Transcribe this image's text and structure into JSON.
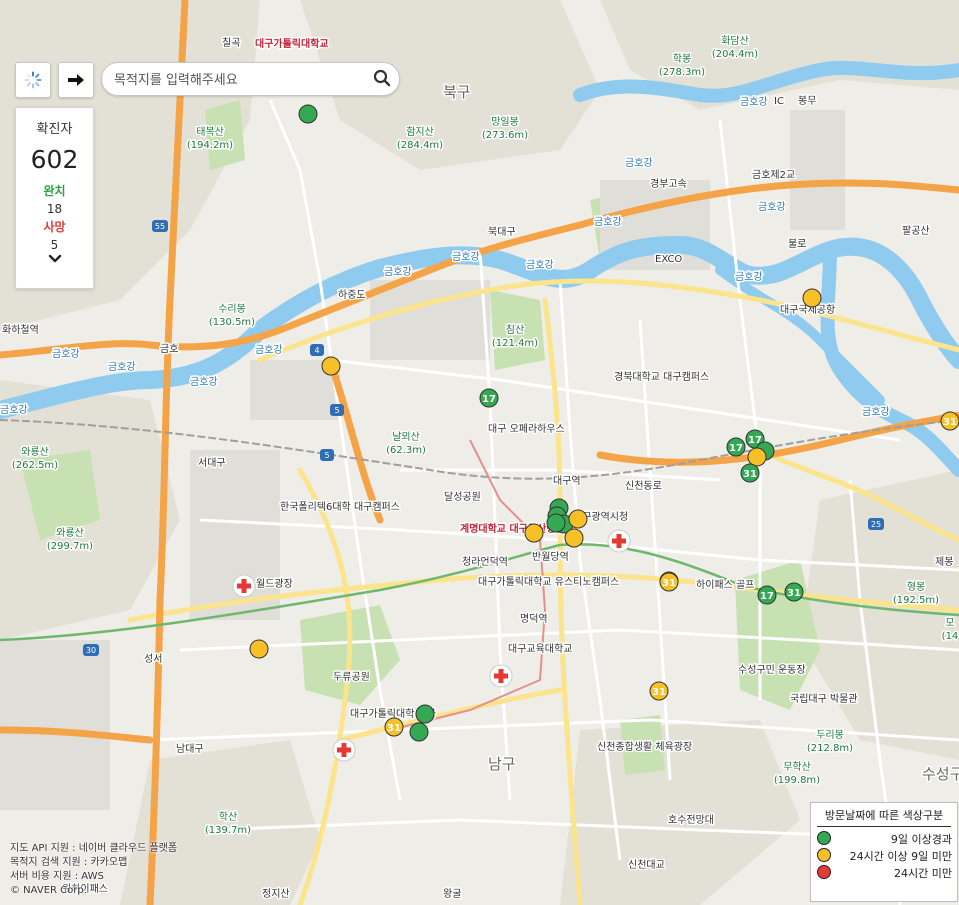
{
  "search": {
    "placeholder": "목적지를 입력해주세요"
  },
  "stats": {
    "confirmed_label": "확진자",
    "confirmed": "602",
    "recovered_label": "완치",
    "recovered": "18",
    "deaths_label": "사망",
    "deaths": "5"
  },
  "attribution": [
    "지도 API 지원 : 네이버 클라우드 플랫폼",
    "목적지 검색 지원 : 카카오맵",
    "서버 비용 지원 : AWS",
    "© NAVER Corp."
  ],
  "legend": {
    "title": "방문날짜에 따른 색상구분",
    "items": [
      {
        "label": "9일 이상경과",
        "color": "#34a853"
      },
      {
        "label": "24시간 이상 9일 미만",
        "color": "#f6c026"
      },
      {
        "label": "24시간 미만",
        "color": "#e53935"
      }
    ]
  },
  "colors": {
    "green": "#34a853",
    "yellow": "#f6c026",
    "red": "#e53935",
    "water": "#7ec3ec",
    "motorway": "#f7b35e",
    "park": "#b9d9a6"
  },
  "map": {
    "districts": [
      "북구",
      "남구",
      "수성구"
    ],
    "rivers": [
      "금호강",
      "금호강",
      "금호강",
      "금호강",
      "금호강",
      "금호강",
      "금호강",
      "금호강",
      "금호강",
      "금호강",
      "금호강",
      "금호강",
      "금호강",
      "금호강"
    ],
    "mountains": [
      {
        "name": "태복산",
        "height": "(194.2m)"
      },
      {
        "name": "함지산",
        "height": "(284.4m)"
      },
      {
        "name": "망일봉",
        "height": "(273.6m)"
      },
      {
        "name": "학봉",
        "height": "(278.3m)"
      },
      {
        "name": "화담산",
        "height": "(204.4m)"
      },
      {
        "name": "수리봉",
        "height": "(130.5m)"
      },
      {
        "name": "침산",
        "height": "(121.4m)"
      },
      {
        "name": "와룡산",
        "height": "(262.5m)"
      },
      {
        "name": "날뫼산",
        "height": "(62.3m)"
      },
      {
        "name": "와룡산",
        "height": "(299.7m)"
      },
      {
        "name": "형봉",
        "height": "(192.5m)"
      },
      {
        "name": "두리봉",
        "height": "(212.8m)"
      },
      {
        "name": "무학산",
        "height": "(199.8m)"
      },
      {
        "name": "학산",
        "height": "(139.7m)"
      },
      {
        "name": "모",
        "height": "(14"
      }
    ],
    "places": [
      "칠곡",
      "대구가톨릭대학교",
      "봉무",
      "IC",
      "금호제2교",
      "경부고속",
      "북대구",
      "EXCO",
      "불로",
      "팔공산",
      "하중도",
      "금호",
      "대구국제공항",
      "화하철역",
      "대구 오페라하우스",
      "경북대학교 대구캠퍼스",
      "서대구",
      "대구역",
      "달성공원",
      "신천동로",
      "대구광역시청",
      "계명대학교 대구동산병원",
      "반월당역",
      "한국폴리텍6대학 대구캠퍼스",
      "청라언덕역",
      "대구가톨릭대학교 유스티노캠퍼스",
      "명덕역",
      "하이패스 골프",
      "제봉",
      "월드광장",
      "성서",
      "두류공원",
      "대구교육대학교",
      "대구가톨릭대학 루가",
      "남대구",
      "수성구민 운동장",
      "국립대구 박물관",
      "신천종합생활 체육광장",
      "호수전망대",
      "신천대교",
      "정지산",
      "왕굴",
      "워하이패스"
    ],
    "route_numbers": [
      "55",
      "4",
      "5",
      "5",
      "30",
      "25"
    ],
    "markers": [
      {
        "color": "green",
        "label": ""
      },
      {
        "color": "yellow",
        "label": ""
      },
      {
        "color": "green",
        "label": "17"
      },
      {
        "color": "yellow",
        "label": ""
      },
      {
        "color": "green",
        "label": "17"
      },
      {
        "color": "green",
        "label": "17"
      },
      {
        "color": "green",
        "label": ""
      },
      {
        "color": "yellow",
        "label": ""
      },
      {
        "color": "green",
        "label": "31"
      },
      {
        "color": "yellow",
        "label": "31"
      },
      {
        "color": "green",
        "label": ""
      },
      {
        "color": "green",
        "label": ""
      },
      {
        "color": "green",
        "label": ""
      },
      {
        "color": "yellow",
        "label": ""
      },
      {
        "color": "yellow",
        "label": ""
      },
      {
        "color": "yellow",
        "label": ""
      },
      {
        "color": "yellow",
        "label": ""
      },
      {
        "color": "yellow",
        "label": "31"
      },
      {
        "color": "green",
        "label": "17"
      },
      {
        "color": "green",
        "label": "31"
      },
      {
        "color": "yellow",
        "label": "31"
      },
      {
        "color": "yellow",
        "label": ""
      },
      {
        "color": "green",
        "label": ""
      },
      {
        "color": "green",
        "label": ""
      },
      {
        "color": "yellow",
        "label": "31"
      },
      {
        "color": "green",
        "label": ""
      }
    ],
    "hospital_icon": "red-cross-icon"
  }
}
